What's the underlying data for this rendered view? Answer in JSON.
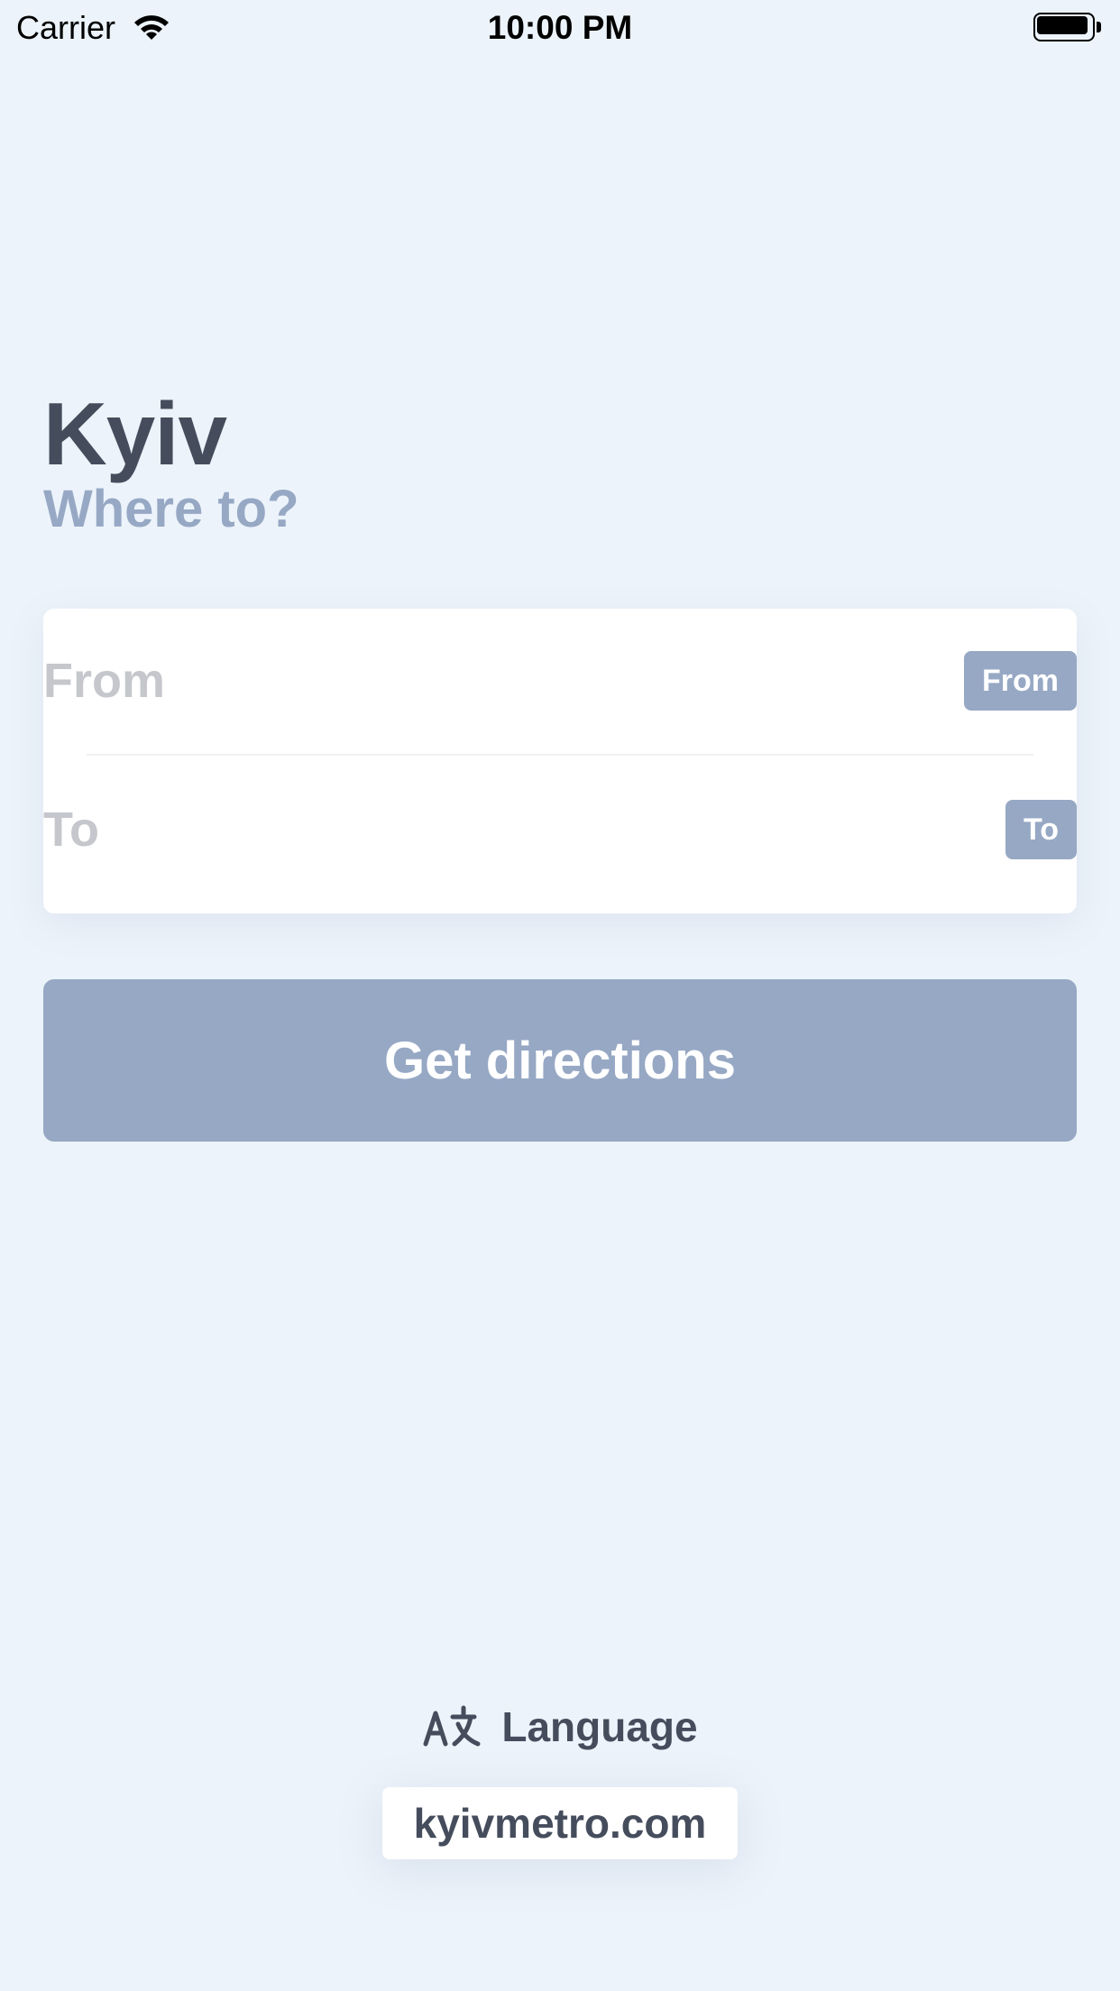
{
  "status_bar": {
    "carrier": "Carrier",
    "time": "10:00 PM",
    "wifi_icon": "wifi-icon",
    "battery_icon": "battery-icon"
  },
  "header": {
    "city": "Kyiv",
    "subtitle": "Where to?"
  },
  "route": {
    "from_placeholder": "From",
    "from_badge": "From",
    "to_placeholder": "To",
    "to_badge": "To"
  },
  "directions_button": {
    "label": "Get directions"
  },
  "footer": {
    "language_icon": "translate-icon",
    "language_label": "Language",
    "website_link": "kyivmetro.com"
  },
  "colors": {
    "background": "#ecf3fa",
    "title_text": "#454d5d",
    "accent": "#96a8c4",
    "card": "#ffffff",
    "placeholder": "#c5c7cc"
  }
}
